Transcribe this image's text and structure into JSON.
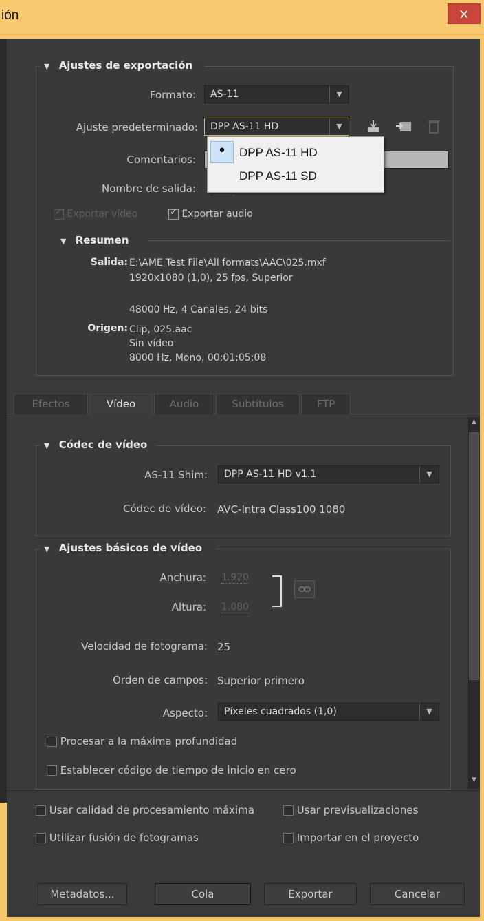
{
  "window": {
    "title": "ión",
    "close_glyph": "×"
  },
  "export": {
    "heading": "Ajustes de exportación",
    "format_label": "Formato:",
    "format_value": "AS-11",
    "preset_label": "Ajuste predeterminado:",
    "preset_value": "DPP AS-11 HD",
    "comments_label": "Comentarios:",
    "output_name_label": "Nombre de salida:",
    "export_video": "Exportar vídeo",
    "export_audio": "Exportar audio",
    "preset_options": [
      "DPP AS-11 HD",
      "DPP AS-11 SD"
    ]
  },
  "summary": {
    "heading": "Resumen",
    "output_label": "Salida:",
    "output_lines": [
      "E:\\AME Test File\\All formats\\AAC\\025.mxf",
      "1920x1080 (1,0), 25 fps, Superior",
      "48000 Hz, 4 Canales, 24 bits"
    ],
    "source_label": "Origen:",
    "source_lines": [
      "Clip, 025.aac",
      "Sin vídeo",
      "8000 Hz, Mono, 00;01;05;08"
    ]
  },
  "tabs": [
    "Efectos",
    "Vídeo",
    "Audio",
    "Subtítulos",
    "FTP"
  ],
  "video_codec": {
    "heading": "Códec de vídeo",
    "shim_label": "AS-11 Shim:",
    "shim_value": "DPP AS-11 HD v1.1",
    "codec_label": "Códec de vídeo:",
    "codec_value": "AVC-Intra Class100 1080"
  },
  "basic_video": {
    "heading": "Ajustes básicos de vídeo",
    "width_label": "Anchura:",
    "width_value": "1.920",
    "height_label": "Altura:",
    "height_value": "1.080",
    "framerate_label": "Velocidad de fotograma:",
    "framerate_value": "25",
    "field_order_label": "Orden de campos:",
    "field_order_value": "Superior primero",
    "aspect_label": "Aspecto:",
    "aspect_value": "Píxeles cuadrados (1,0)",
    "max_depth": "Procesar a la máxima profundidad",
    "timecode_zero": "Establecer código de tiempo de inicio en cero"
  },
  "options": {
    "max_quality": "Usar calidad de procesamiento máxima",
    "previews": "Usar previsualizaciones",
    "frame_blend": "Utilizar fusión de fotogramas",
    "import_project": "Importar en el proyecto"
  },
  "buttons": {
    "metadata": "Metadatos...",
    "queue": "Cola",
    "export": "Exportar",
    "cancel": "Cancelar"
  },
  "colors": {
    "title_bar": "#f8c96e",
    "panel": "#393939",
    "close": "#c9443a"
  }
}
